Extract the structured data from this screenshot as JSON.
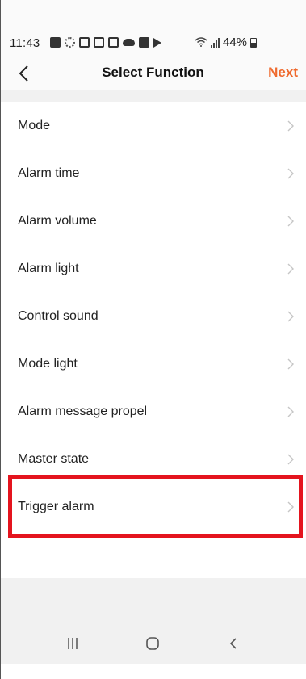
{
  "status_bar": {
    "time": "11:43",
    "battery_percent": "44%",
    "notification_icons": [
      "teams-icon",
      "sync-icon",
      "square-app-icon",
      "gmail-icon",
      "gallery-icon",
      "cloud-icon",
      "youtube-icon",
      "play-icon"
    ]
  },
  "header": {
    "title": "Select Function",
    "next_label": "Next",
    "accent_color": "#ef6a2e"
  },
  "functions": [
    {
      "label": "Mode"
    },
    {
      "label": "Alarm time"
    },
    {
      "label": "Alarm volume"
    },
    {
      "label": "Alarm light"
    },
    {
      "label": "Control sound"
    },
    {
      "label": "Mode light"
    },
    {
      "label": "Alarm message propel"
    },
    {
      "label": "Master state"
    },
    {
      "label": "Trigger alarm"
    }
  ],
  "highlight": {
    "item": "Trigger alarm",
    "color": "#e4141e"
  },
  "nav_bar": {
    "buttons": [
      "recent-apps-icon",
      "home-icon",
      "back-icon"
    ]
  }
}
